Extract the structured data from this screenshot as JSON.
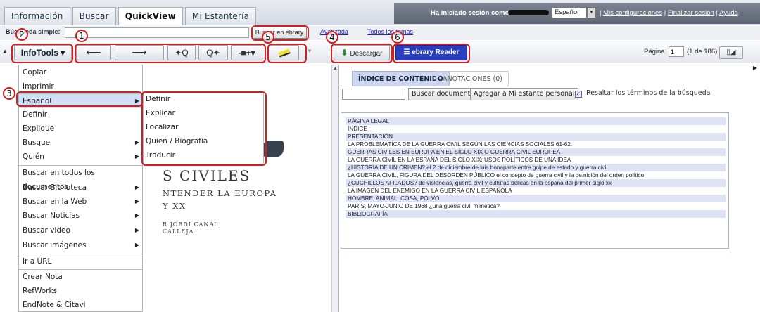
{
  "tabs": [
    "Información",
    "Buscar",
    "QuickView",
    "Mi Estantería"
  ],
  "session": {
    "label": "Ha iniciado sesión como:",
    "language": "Español",
    "links": [
      "Mis configuraciones",
      "Finalizar sesión",
      "Ayuda"
    ]
  },
  "search": {
    "label": "Búsqueda simple:",
    "placeholder": "",
    "button": "Buscar en ebrary",
    "link_advanced": "Avanzada",
    "link_all_topics": "Todos los temas"
  },
  "toolbar": {
    "infotools": "InfoTools",
    "descargar": "Descargar",
    "reader": "ebrary Reader",
    "page_label": "Página",
    "page_value": "1",
    "page_total": "(1 de 186)"
  },
  "callouts": [
    "1",
    "2",
    "3",
    "4",
    "5",
    "6"
  ],
  "menu": {
    "items": [
      {
        "label": "Copiar",
        "submenu": false
      },
      {
        "label": "Imprimir",
        "submenu": false
      },
      {
        "label": "Español",
        "submenu": true
      },
      {
        "label": "Definir",
        "submenu": false
      },
      {
        "label": "Explique",
        "submenu": false
      },
      {
        "label": "Busque",
        "submenu": true
      },
      {
        "label": "Quién",
        "submenu": true
      },
      {
        "label": "Buscar en todos los documentos",
        "submenu": false
      },
      {
        "label": "Buscar Biblioteca",
        "submenu": true
      },
      {
        "label": "Buscar en la Web",
        "submenu": true
      },
      {
        "label": "Buscar Noticias",
        "submenu": true
      },
      {
        "label": "Buscar video",
        "submenu": true
      },
      {
        "label": "Buscar imágenes",
        "submenu": true
      },
      {
        "label": "Ir a URL",
        "submenu": false
      },
      {
        "label": "Crear Nota",
        "submenu": false
      },
      {
        "label": "RefWorks",
        "submenu": false
      },
      {
        "label": "EndNote & Citavi",
        "submenu": false
      }
    ],
    "submenu": [
      "Definir",
      "Explicar",
      "Localizar",
      "Quien / Biografía",
      "Traducir"
    ]
  },
  "book": {
    "title": "S CIVILES",
    "subtitle": "NTENDER LA EUROPA",
    "subtitle2": "Y XX",
    "authors": "R JORDI CANAL",
    "authors2": "CALLEJA"
  },
  "panel": {
    "tabs": [
      "ÍNDICE DE CONTENIDO",
      "ANOTACIONES (0)"
    ],
    "search_button": "Buscar documento",
    "add_button": "Agregar a Mi estante personal",
    "highlight_label": "Resaltar los términos de la búsqueda",
    "toc": [
      "PÁGINA LEGAL",
      "ÍNDICE",
      "PRESENTACIÓN",
      "LA PROBLEMÁTICA DE LA GUERRA CIVIL SEGÚN LAS CIENCIAS SOCIALES 61-62.",
      "GUERRAS CIVILES EN EUROPA EN EL SIGLO XIX O GUERRA CIVIL EUROPEA",
      "LA GUERRA CIVIL EN LA ESPAÑA DEL SIGLO XIX: USOS POLÍTICOS DE UNA IDEA",
      "¿HISTORIA DE UN CRIMEN? el 2 de diciembre de luis bonaparte entre golpe de estado y guerra civil",
      "LA GUERRA CIVIL, FIGURA DEL DESORDEN PÚBLICO el concepto de guerra civil y la de.nición del orden político",
      "¿CUCHILLOS AFILADOS? de violencias, guerra civil y culturas bélicas en la españa del primer siglo xx",
      "LA IMAGEN DEL ENEMIGO EN LA GUERRA CIVIL ESPAÑOLA",
      "HOMBRE, ANIMAL, COSA, POLVO",
      "PARÍS, MAYO-JUNIO DE 1968 ¿una guerra civil mimética?",
      "BIBLIOGRAFÍA"
    ]
  },
  "colors": {
    "callout": "#d21f1f",
    "accent": "#2a3fbf",
    "highlight": "#cfe0f6"
  },
  "icons": [
    "arrow-left-icon",
    "arrow-right-icon",
    "zoom-out-icon",
    "zoom-in-icon",
    "bookmark-add-icon",
    "highlighter-icon",
    "download-icon",
    "reader-icon",
    "fit-page-icon"
  ]
}
